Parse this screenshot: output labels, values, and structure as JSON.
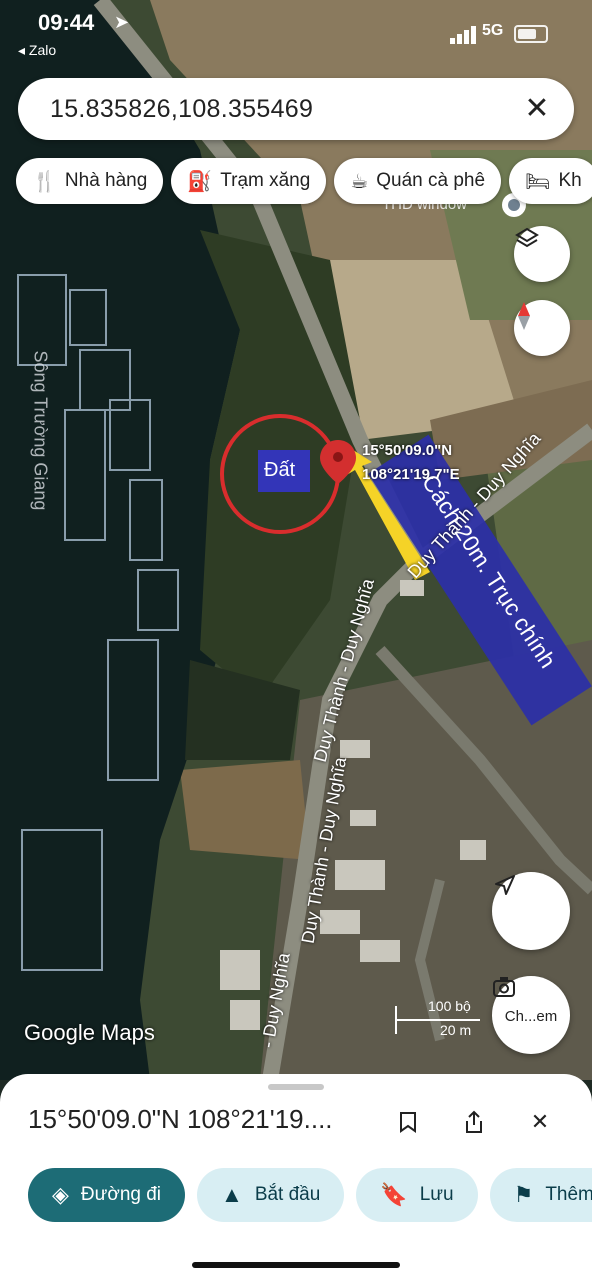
{
  "status_bar": {
    "time": "09:44",
    "back_app": "Zalo",
    "network": "5G"
  },
  "search": {
    "query": "15.835826,108.355469"
  },
  "chips": [
    {
      "icon": "restaurant-icon",
      "label": "Nhà hàng"
    },
    {
      "icon": "gas-station-icon",
      "label": "Trạm xăng"
    },
    {
      "icon": "coffee-icon",
      "label": "Quán cà phê"
    },
    {
      "icon": "hotel-icon",
      "label": "Kh"
    }
  ],
  "map": {
    "place_label": "THD window",
    "river_label": "Sông Trường Giang",
    "road_label_1": "Duy Thành - Duy Nghĩa",
    "road_label_2": "Duy Thành - Duy Nghĩa",
    "road_label_3": "Duy Thành - Duy Nghĩa",
    "road_label_4": "- Duy Nghĩa",
    "pin_lat": "15°50'09.0\"N",
    "pin_lng": "108°21'19.7\"E",
    "annotation_land": "Đất",
    "annotation_distance": "Cách 20m. Trục chính",
    "attribution": "Google Maps",
    "scale_ft": "100 bộ",
    "scale_m": "20 m",
    "check_label": "Ch...em"
  },
  "sheet": {
    "coords": "15°50'09.0\"N 108°21'19....",
    "actions": [
      {
        "icon": "directions-icon",
        "label": "Đường đi",
        "primary": true
      },
      {
        "icon": "navigation-start-icon",
        "label": "Bắt đầu",
        "primary": false
      },
      {
        "icon": "bookmark-icon",
        "label": "Lưu",
        "primary": false
      },
      {
        "icon": "flag-icon",
        "label": "Thêm",
        "primary": false
      }
    ]
  },
  "colors": {
    "accent": "#1d6c76",
    "action_bg": "#d8eef3",
    "pin": "#d32f2f",
    "annotation_box": "#2b2fa8",
    "arrow": "#f5d327"
  }
}
